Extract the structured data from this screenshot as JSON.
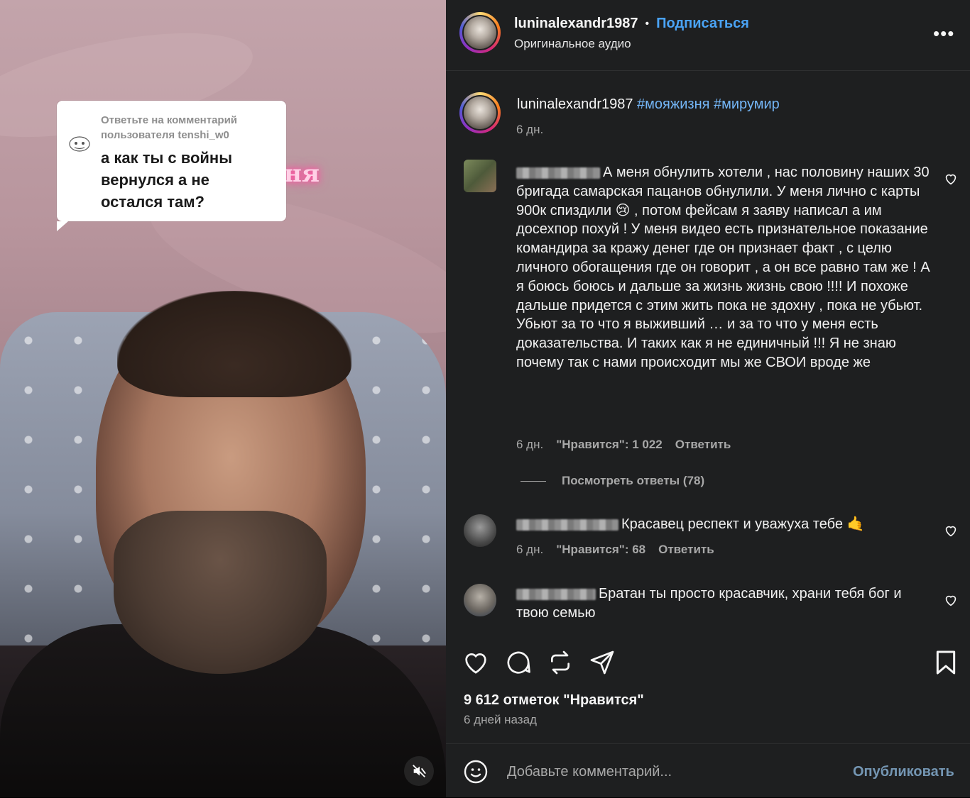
{
  "video": {
    "reply_header": "Ответьте на комментарий пользователя tenshi_w0",
    "question": "а как ты с войны вернулся а не остался там?",
    "neon_text": "ня",
    "mute_icon": "speaker-muted-icon"
  },
  "header": {
    "username": "luninalexandr1987",
    "separator": "•",
    "follow_label": "Подписаться",
    "audio_label": "Оригинальное аудио",
    "more_label": "•••"
  },
  "caption": {
    "username": "luninalexandr1987",
    "hashtags": "#мояжизня #мирумир",
    "time": "6 дн."
  },
  "comments": [
    {
      "text": "А меня обнулить хотели , нас половину наших 30 бригада самарская пацанов обнулили. У меня лично с карты 900к спиздили 😢 , потом фейсам я заяву написал а им досехпор похуй ! У меня видео есть признательное показание командира за кражу денег где он признает факт , с целю личного обогащения где он говорит , а он все равно там же ! А я боюсь боюсь и дальше за жизнь жизнь свою !!!! И похоже дальше придется с этим жить пока не здохну , пока не убьют. Убьют за то что я выживший … и за то что у меня есть доказательства. И таких как я не единичный !!! Я не знаю почему так с нами происходит мы же СВОИ вроде же",
      "time": "6 дн.",
      "likes": "\"Нравится\": 1 022",
      "reply": "Ответить"
    },
    {
      "text": "Красавец респект и уважуха тебе 🤙",
      "time": "6 дн.",
      "likes": "\"Нравится\": 68",
      "reply": "Ответить"
    },
    {
      "text": "Братан ты просто красавчик, храни тебя бог и твою семью"
    }
  ],
  "view_replies": "Посмотреть ответы (78)",
  "stats": {
    "likes": "9 612 отметок \"Нравится\"",
    "ago": "6 дней назад"
  },
  "composer": {
    "placeholder": "Добавьте комментарий...",
    "publish": "Опубликовать"
  },
  "colors": {
    "panel_bg": "#1e1f20",
    "link_blue": "#4aa3f5",
    "hashtag_blue": "#74b6f7",
    "muted": "#a8a8a8"
  }
}
